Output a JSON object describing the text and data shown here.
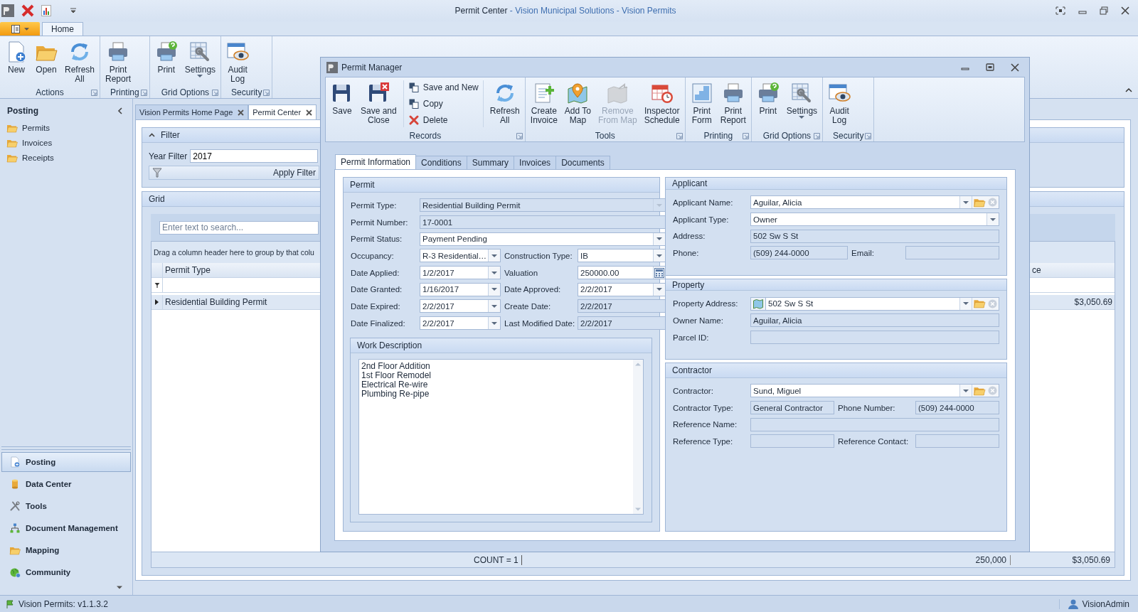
{
  "app": {
    "title": "Permit Center",
    "title_suffix": "- Vision Municipal Solutions - Vision Permits"
  },
  "ribbon": {
    "tabs": [
      {
        "label": "Home",
        "selected": true
      }
    ],
    "groups": [
      {
        "label": "Actions",
        "items": [
          {
            "label": "New",
            "kind": "new",
            "menu": false,
            "disabled": false
          },
          {
            "label": "Open",
            "kind": "open",
            "menu": false,
            "disabled": false
          },
          {
            "label": "Refresh\nAll",
            "kind": "refresh",
            "menu": false,
            "disabled": false
          }
        ]
      },
      {
        "label": "Printing",
        "items": [
          {
            "label": "Print\nReport",
            "kind": "printer",
            "menu": false,
            "disabled": false
          }
        ]
      },
      {
        "label": "Grid Options",
        "items": [
          {
            "label": "Print",
            "kind": "printhelp",
            "menu": false,
            "disabled": false
          },
          {
            "label": "Settings",
            "kind": "settings",
            "menu": true,
            "disabled": false
          }
        ]
      },
      {
        "label": "Security",
        "items": [
          {
            "label": "Audit\nLog",
            "kind": "audit",
            "menu": false,
            "disabled": false
          }
        ]
      }
    ]
  },
  "sidebar": {
    "title": "Posting",
    "items": [
      {
        "label": "Permits"
      },
      {
        "label": "Invoices"
      },
      {
        "label": "Receipts"
      }
    ]
  },
  "nav": [
    {
      "label": "Posting",
      "kind": "posting",
      "selected": true
    },
    {
      "label": "Data Center",
      "kind": "database",
      "selected": false
    },
    {
      "label": "Tools",
      "kind": "tools",
      "selected": false
    },
    {
      "label": "Document Management",
      "kind": "network",
      "selected": false
    },
    {
      "label": "Mapping",
      "kind": "folder",
      "selected": false
    },
    {
      "label": "Community",
      "kind": "globe",
      "selected": false
    }
  ],
  "doc_tabs": [
    {
      "label": "Vision Permits Home Page",
      "selected": false
    },
    {
      "label": "Permit Center",
      "selected": true
    }
  ],
  "filter": {
    "title": "Filter",
    "year_label": "Year Filter",
    "year_value": "2017",
    "apply": "Apply Filter"
  },
  "grid": {
    "title": "Grid",
    "search_placeholder": "Enter text to search...",
    "group_hint": "Drag a column header here to group by that colu",
    "columns": [
      {
        "label": "Permit Type"
      },
      {
        "label": "ce"
      }
    ],
    "rows": [
      {
        "cells": [
          "Residential Building Permit",
          "$3,050.69"
        ]
      }
    ],
    "summary": [
      "COUNT = 1",
      "250,000",
      "$3,050.69"
    ]
  },
  "permit_manager": {
    "title": "Permit Manager",
    "groups": [
      {
        "label": "Records",
        "items": [
          {
            "label": "Save",
            "kind": "save",
            "menu": false,
            "disabled": false
          },
          {
            "label": "Save and\nClose",
            "kind": "saveclose",
            "menu": false,
            "disabled": false
          },
          {
            "kind": "stack",
            "buttons": [
              {
                "label": "Save and New",
                "kind": "savenew"
              },
              {
                "label": "Copy",
                "kind": "copy"
              },
              {
                "label": "Delete",
                "kind": "delete"
              }
            ]
          },
          {
            "label": "Refresh\nAll",
            "kind": "refresh",
            "menu": false,
            "disabled": false
          }
        ]
      },
      {
        "label": "Tools",
        "items": [
          {
            "label": "Create\nInvoice",
            "kind": "invoice",
            "menu": false,
            "disabled": false
          },
          {
            "label": "Add To\nMap",
            "kind": "addmap",
            "menu": false,
            "disabled": false
          },
          {
            "label": "Remove\nFrom Map",
            "kind": "removemap",
            "menu": false,
            "disabled": true
          },
          {
            "label": "Inspector\nSchedule",
            "kind": "schedule",
            "menu": false,
            "disabled": false
          }
        ]
      },
      {
        "label": "Printing",
        "items": [
          {
            "label": "Print\nForm",
            "kind": "form",
            "menu": false,
            "disabled": false
          },
          {
            "label": "Print\nReport",
            "kind": "printer",
            "menu": false,
            "disabled": false
          }
        ]
      },
      {
        "label": "Grid Options",
        "items": [
          {
            "label": "Print",
            "kind": "printhelp",
            "menu": false,
            "disabled": false
          },
          {
            "label": "Settings",
            "kind": "settings",
            "menu": true,
            "disabled": false
          }
        ]
      },
      {
        "label": "Security",
        "items": [
          {
            "label": "Audit\nLog",
            "kind": "audit",
            "menu": false,
            "disabled": false
          }
        ]
      }
    ],
    "tabs": [
      {
        "label": "Permit Information",
        "selected": true
      },
      {
        "label": "Conditions",
        "selected": false
      },
      {
        "label": "Summary",
        "selected": false
      },
      {
        "label": "Invoices",
        "selected": false
      },
      {
        "label": "Documents",
        "selected": false
      }
    ],
    "permit": {
      "title": "Permit",
      "rows": [
        [
          {
            "label": "Permit Type:",
            "value": "Residential Building Permit",
            "kind": "lockedcombo"
          }
        ],
        [
          {
            "label": "Permit Number:",
            "value": "17-0001",
            "kind": "readonly"
          }
        ],
        [
          {
            "label": "Permit Status:",
            "value": "Payment Pending",
            "kind": "combo"
          }
        ],
        [
          {
            "label": "Occupancy:",
            "value": "R-3 Residential…",
            "kind": "combo"
          },
          {
            "label": "Construction Type:",
            "value": "IB",
            "kind": "combo"
          }
        ],
        [
          {
            "label": "Date Applied:",
            "value": "1/2/2017",
            "kind": "combo"
          },
          {
            "label": "Valuation",
            "value": "250000.00",
            "kind": "calc"
          }
        ],
        [
          {
            "label": "Date Granted:",
            "value": "1/16/2017",
            "kind": "combo"
          },
          {
            "label": "Date Approved:",
            "value": "2/2/2017",
            "kind": "combo"
          }
        ],
        [
          {
            "label": "Date Expired:",
            "value": "2/2/2017",
            "kind": "combo"
          },
          {
            "label": "Create Date:",
            "value": "2/2/2017",
            "kind": "readonly"
          }
        ],
        [
          {
            "label": "Date Finalized:",
            "value": "2/2/2017",
            "kind": "combo"
          },
          {
            "label": "Last Modified Date:",
            "value": "2/2/2017",
            "kind": "readonly"
          }
        ]
      ],
      "work_description": {
        "title": "Work Description",
        "lines": [
          "2nd Floor Addition",
          "1st Floor Remodel",
          "Electrical Re-wire",
          "Plumbing Re-pipe"
        ]
      }
    },
    "applicant": {
      "title": "Applicant",
      "rows": [
        [
          {
            "label": "Applicant Name:",
            "value": "Aguilar,  Alicia",
            "kind": "lookup"
          }
        ],
        [
          {
            "label": "Applicant Type:",
            "value": "Owner",
            "kind": "combo"
          }
        ],
        [
          {
            "label": "Address:",
            "value": "502 Sw S St",
            "kind": "readonly"
          }
        ],
        [
          {
            "label": "Phone:",
            "value": "(509) 244-0000",
            "kind": "readonly"
          },
          {
            "label": "Email:",
            "kind": "readonly"
          }
        ]
      ]
    },
    "property": {
      "title": "Property",
      "rows": [
        [
          {
            "label": "Property Address:",
            "value": "502 Sw S St",
            "kind": "maplookup"
          }
        ],
        [
          {
            "label": "Owner Name:",
            "value": "Aguilar,  Alicia",
            "kind": "readonly"
          }
        ],
        [
          {
            "label": "Parcel ID:",
            "kind": "readonly"
          }
        ]
      ]
    },
    "contractor": {
      "title": "Contractor",
      "rows": [
        [
          {
            "label": "Contractor:",
            "value": "Sund,  Miguel",
            "kind": "lookup"
          }
        ],
        [
          {
            "label": "Contractor Type:",
            "value": "General Contractor",
            "kind": "readonly"
          },
          {
            "label": "Phone Number:",
            "value": "(509) 244-0000",
            "kind": "readonly"
          }
        ],
        [
          {
            "label": "Reference Name:",
            "kind": "readonly"
          }
        ],
        [
          {
            "label": "Reference Type:",
            "kind": "readonly"
          },
          {
            "label": "Reference Contact:",
            "kind": "readonly"
          }
        ]
      ]
    }
  },
  "status_bar": {
    "version": "Vision Permits: v1.1.3.2",
    "user": "VisionAdmin"
  }
}
